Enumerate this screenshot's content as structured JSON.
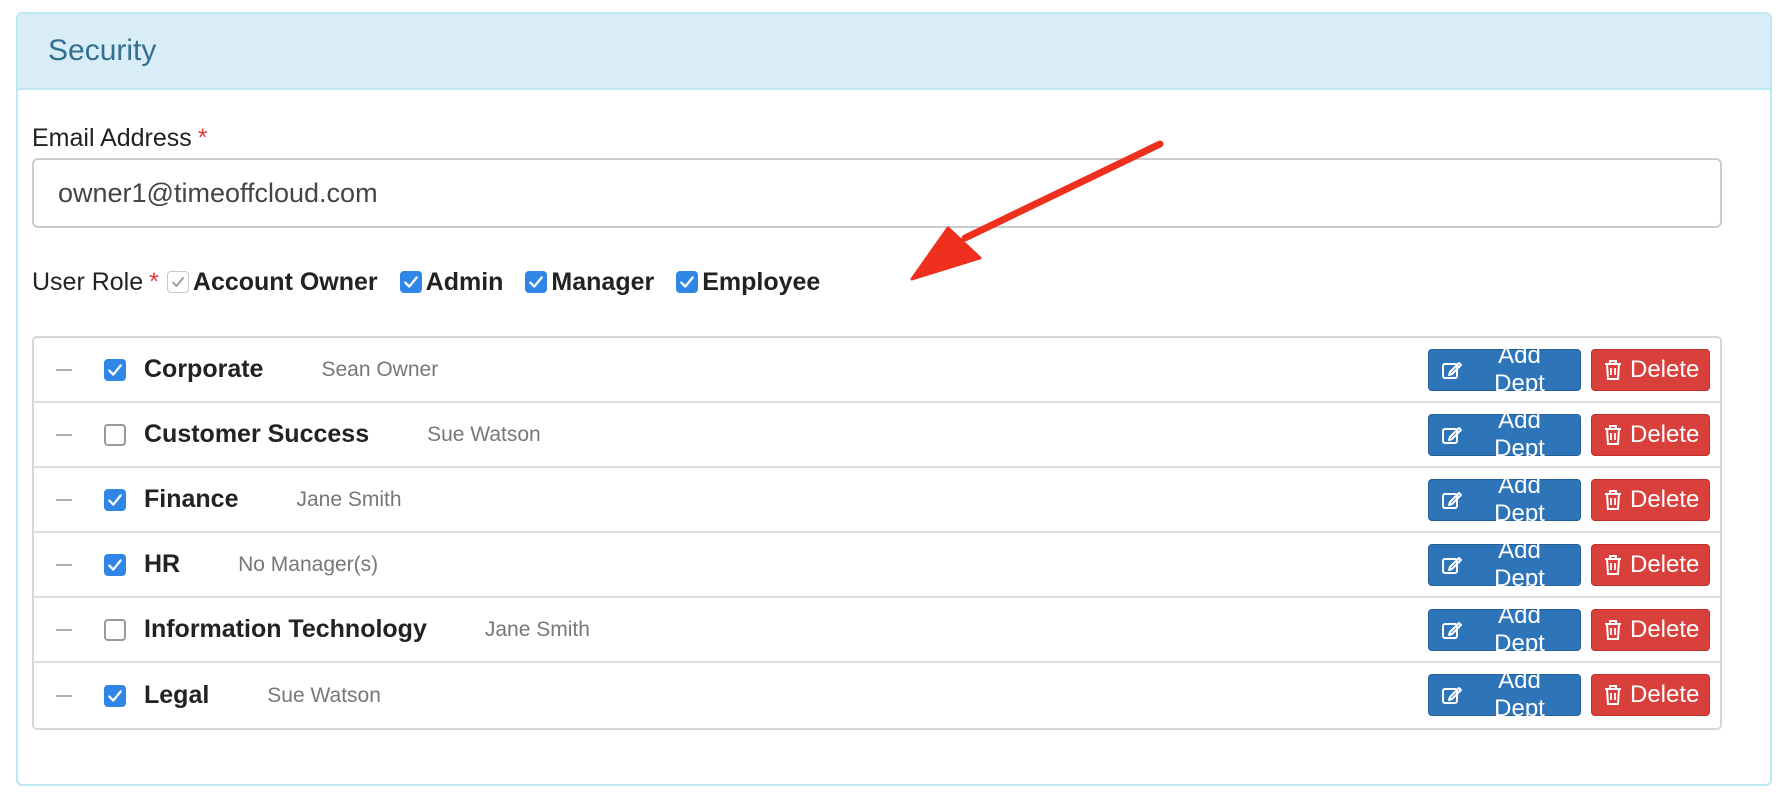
{
  "panel": {
    "title": "Security"
  },
  "email": {
    "label": "Email Address",
    "required_marker": "*",
    "value": "owner1@timeoffcloud.com"
  },
  "user_role": {
    "label": "User Role",
    "required_marker": "*",
    "roles": [
      {
        "label": "Account Owner",
        "checked": true,
        "disabled": true
      },
      {
        "label": "Admin",
        "checked": true,
        "disabled": false
      },
      {
        "label": "Manager",
        "checked": true,
        "disabled": false
      },
      {
        "label": "Employee",
        "checked": true,
        "disabled": false
      }
    ]
  },
  "departments": [
    {
      "name": "Corporate",
      "manager": "Sean Owner",
      "checked": true
    },
    {
      "name": "Customer Success",
      "manager": "Sue Watson",
      "checked": false
    },
    {
      "name": "Finance",
      "manager": "Jane Smith",
      "checked": true
    },
    {
      "name": "HR",
      "manager": "No Manager(s)",
      "checked": true
    },
    {
      "name": "Information Technology",
      "manager": "Jane Smith",
      "checked": false
    },
    {
      "name": "Legal",
      "manager": "Sue Watson",
      "checked": true
    }
  ],
  "buttons": {
    "add_dept": "Add Dept",
    "delete": "Delete"
  },
  "colors": {
    "panel_heading_bg": "#d9edf7",
    "panel_title": "#31708f",
    "checkbox_on": "#2f86e6",
    "primary": "#2e74b8",
    "danger": "#d9403b",
    "annotation_arrow": "#f0301e"
  },
  "icons": {
    "add_dept": "edit-icon",
    "delete": "trash-icon",
    "handle": "drag-handle-icon",
    "annotation": "red-arrow-icon"
  }
}
